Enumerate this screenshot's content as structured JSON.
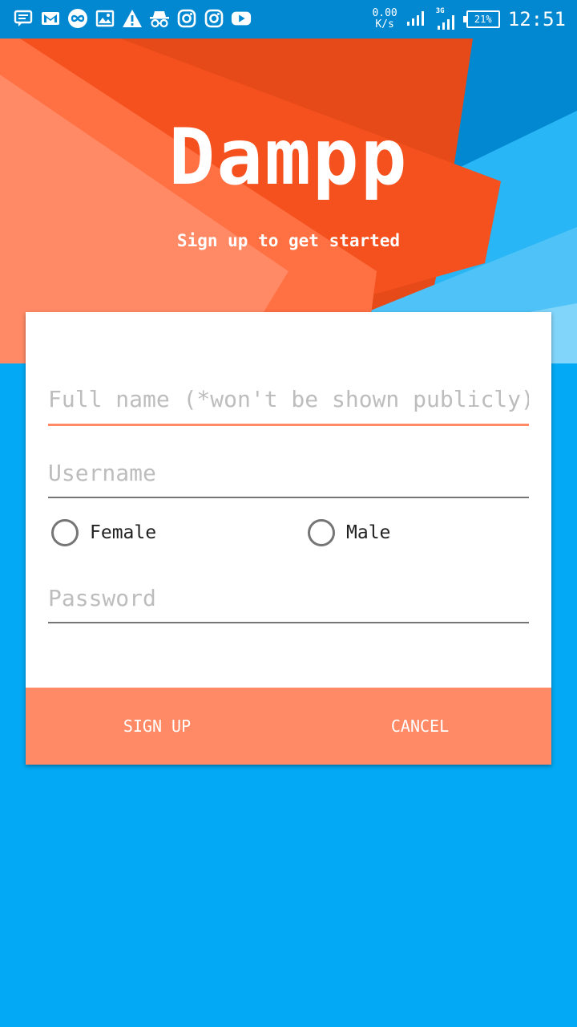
{
  "status_bar": {
    "icons": [
      "message-icon",
      "gmail-icon",
      "infinity-icon",
      "image-icon",
      "warning-icon",
      "incognito-icon",
      "instagram-icon",
      "instagram-icon",
      "youtube-icon"
    ],
    "net_speed_value": "0.00",
    "net_speed_unit": "K/s",
    "network_type": "3G",
    "battery": "21%",
    "time": "12:51"
  },
  "header": {
    "app_name": "Dampp",
    "tagline": "Sign up to get started"
  },
  "form": {
    "full_name": {
      "value": "",
      "placeholder": "Full name (*won't be shown publicly)"
    },
    "username": {
      "value": "",
      "placeholder": "Username"
    },
    "gender_options": [
      "Female",
      "Male"
    ],
    "password": {
      "value": "",
      "placeholder": "Password"
    }
  },
  "actions": {
    "sign_up_label": "SIGN UP",
    "cancel_label": "CANCEL"
  },
  "colors": {
    "background": "#03A9F4",
    "status_bar": "#0288D1",
    "accent": "#FF8A65",
    "hero_orange": "#F4511E"
  }
}
